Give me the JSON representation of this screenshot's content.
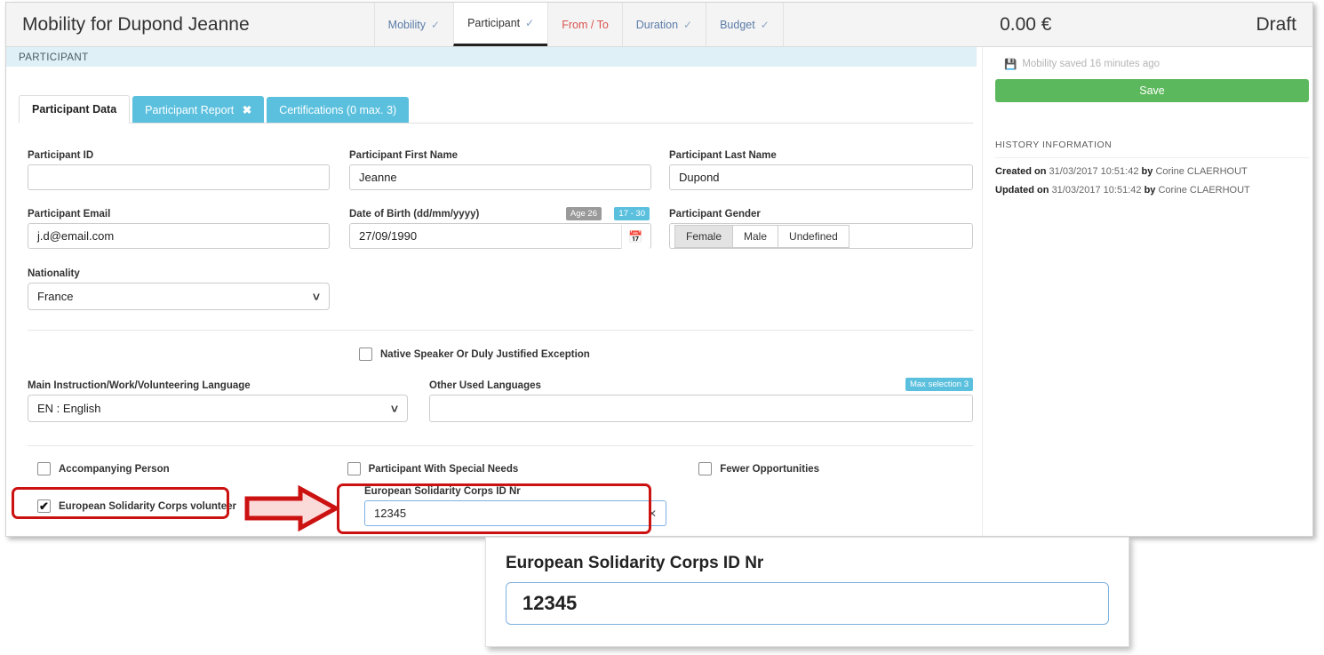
{
  "header": {
    "title": "Mobility for Dupond Jeanne",
    "amount": "0.00 €",
    "status": "Draft",
    "tabs": [
      {
        "label": "Mobility",
        "tick": "✓",
        "state": "done"
      },
      {
        "label": "Participant",
        "tick": "✓",
        "state": "active"
      },
      {
        "label": "From / To",
        "tick": "",
        "state": "warn"
      },
      {
        "label": "Duration",
        "tick": "✓",
        "state": "done"
      },
      {
        "label": "Budget",
        "tick": "✓",
        "state": "done"
      }
    ]
  },
  "section": {
    "banner": "PARTICIPANT"
  },
  "subtabs": [
    {
      "label": "Participant Data",
      "style": "selected"
    },
    {
      "label": "Participant Report",
      "close": "✖",
      "style": "cyan"
    },
    {
      "label": "Certifications (0 max. 3)",
      "style": "cyan"
    }
  ],
  "form": {
    "participant_id": {
      "label": "Participant ID",
      "value": ""
    },
    "first_name": {
      "label": "Participant First Name",
      "value": "Jeanne"
    },
    "last_name": {
      "label": "Participant Last Name",
      "value": "Dupond"
    },
    "email": {
      "label": "Participant Email",
      "value": "j.d@email.com"
    },
    "dob": {
      "label": "Date of Birth (dd/mm/yyyy)",
      "value": "27/09/1990",
      "age_badge": "Age 26",
      "range_badge": "17 - 30",
      "calendar_icon": "📅"
    },
    "gender": {
      "label": "Participant Gender",
      "options": [
        "Female",
        "Male",
        "Undefined"
      ],
      "selected": "Female"
    },
    "nationality": {
      "label": "Nationality",
      "value": "France"
    },
    "native_speaker": {
      "label": "Native Speaker Or Duly Justified Exception",
      "checked": false
    },
    "main_language": {
      "label": "Main Instruction/Work/Volunteering Language",
      "value": "EN : English"
    },
    "other_languages": {
      "label": "Other Used Languages",
      "value": "",
      "badge": "Max selection 3"
    },
    "accompanying_person": {
      "label": "Accompanying Person",
      "checked": false
    },
    "special_needs": {
      "label": "Participant With Special Needs",
      "checked": false
    },
    "fewer_opportunities": {
      "label": "Fewer Opportunities",
      "checked": false
    },
    "esc_volunteer": {
      "label": "European Solidarity Corps volunteer",
      "checked": true,
      "mark": "✔"
    },
    "esc_id": {
      "label": "European Solidarity Corps ID Nr",
      "value": "12345",
      "clear_icon": "✕"
    }
  },
  "sidebar": {
    "saved_text": "Mobility saved 16 minutes ago",
    "save_icon": "💾",
    "save_label": "Save",
    "history_title": "HISTORY INFORMATION",
    "history": [
      {
        "prefix": "Created on",
        "datetime": "31/03/2017 10:51:42",
        "by": "by",
        "user": "Corine CLAERHOUT"
      },
      {
        "prefix": "Updated on",
        "datetime": "31/03/2017 10:51:42",
        "by": "by",
        "user": "Corine CLAERHOUT"
      }
    ]
  },
  "callout": {
    "label": "European Solidarity Corps ID Nr",
    "value": "12345"
  },
  "colors": {
    "accent_cyan": "#5bc0de",
    "save_green": "#5cb85c",
    "annotation_red": "#cc1111",
    "warn_red": "#d9534f",
    "banner_blue": "#dff0f7"
  }
}
